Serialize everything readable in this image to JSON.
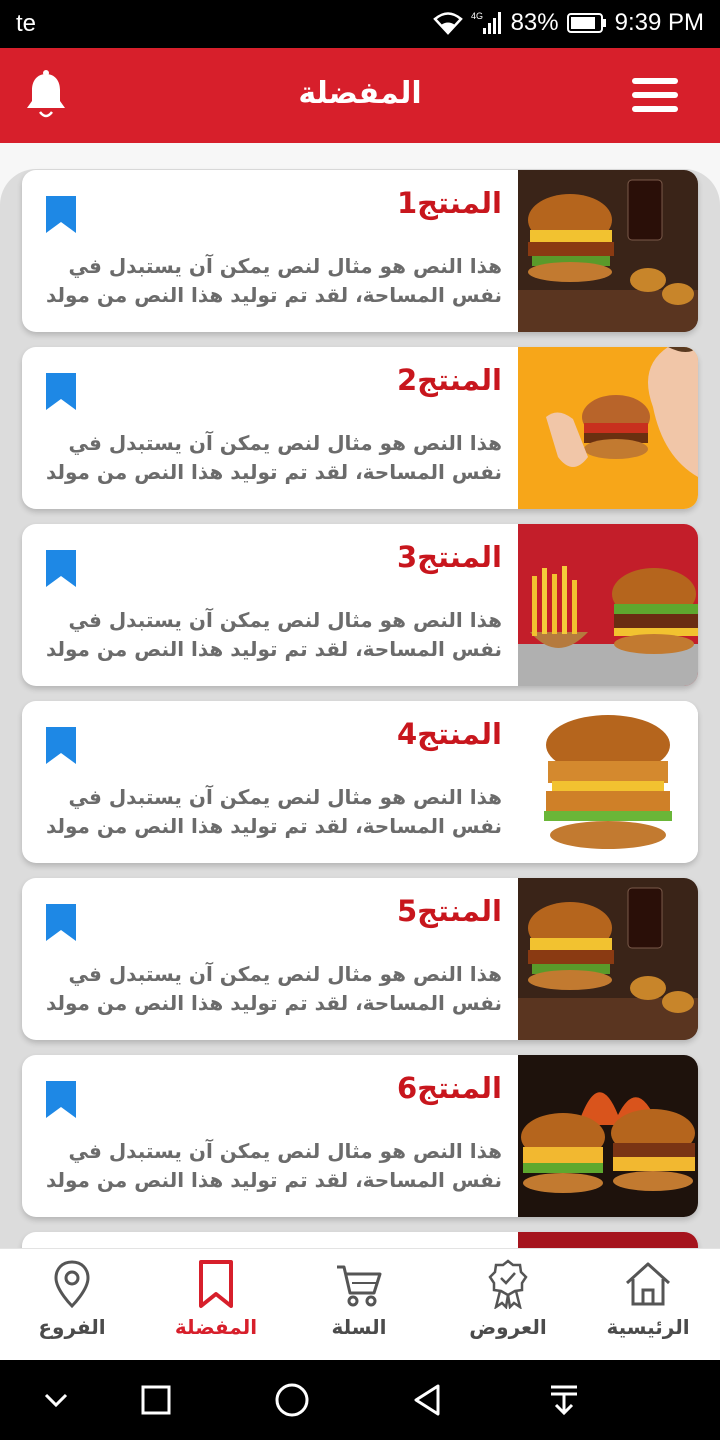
{
  "status_bar": {
    "carrier": "te",
    "network": "4G",
    "battery": "83%",
    "time": "9:39 PM"
  },
  "header": {
    "title": "المفضلة"
  },
  "products": [
    {
      "title": "المنتج1",
      "description": "هذا النص هو مثال لنص يمكن آن يستبدل في نفس المساحة، لقد تم توليد هذا النص من مولد",
      "image": "burger-fries-drink-photo"
    },
    {
      "title": "المنتج2",
      "description": "هذا النص هو مثال لنص يمكن آن يستبدل في نفس المساحة، لقد تم توليد هذا النص من مولد",
      "image": "woman-eating-burger-photo"
    },
    {
      "title": "المنتج3",
      "description": "هذا النص هو مثال لنص يمكن آن يستبدل في نفس المساحة، لقد تم توليد هذا النص من مولد",
      "image": "burger-with-fries-photo"
    },
    {
      "title": "المنتج4",
      "description": "هذا النص هو مثال لنص يمكن آن يستبدل في نفس المساحة، لقد تم توليد هذا النص من مولد",
      "image": "chicken-burger-photo"
    },
    {
      "title": "المنتج5",
      "description": "هذا النص هو مثال لنص يمكن آن يستبدل في نفس المساحة، لقد تم توليد هذا النص من مولد",
      "image": "burger-fries-drink-photo"
    },
    {
      "title": "المنتج6",
      "description": "هذا النص هو مثال لنص يمكن آن يستبدل في نفس المساحة، لقد تم توليد هذا النص من مولد",
      "image": "two-burgers-fire-photo"
    }
  ],
  "bottom_nav": {
    "branches": "الفروع",
    "favorites": "المفضلة",
    "cart": "السلة",
    "offers": "العروض",
    "home": "الرئيسية"
  },
  "colors": {
    "primary": "#d71f2b",
    "bookmark": "#1e88e5",
    "title": "#c8161d"
  }
}
